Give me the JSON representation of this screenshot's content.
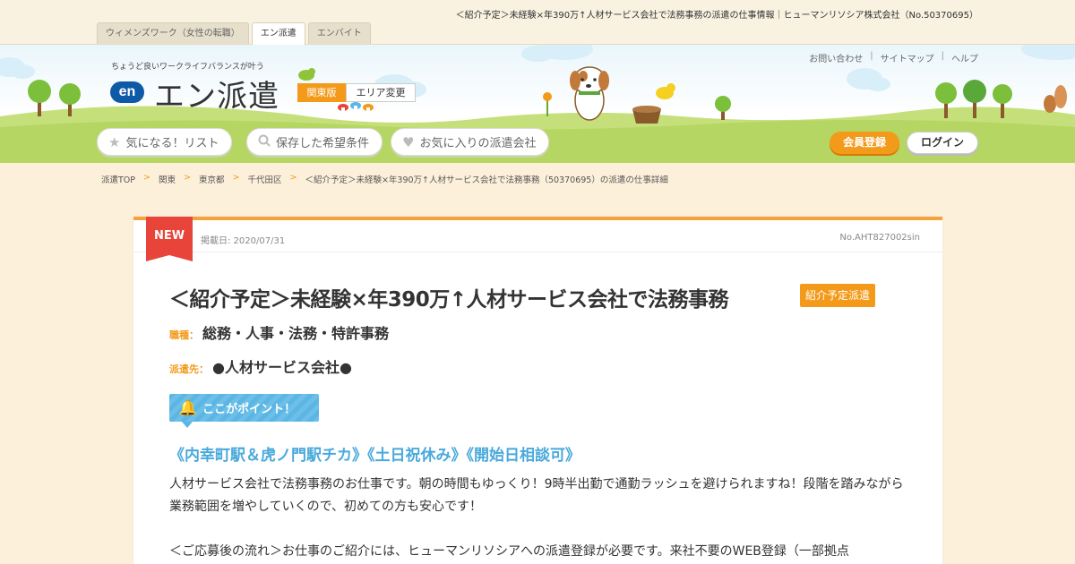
{
  "page_heading": "＜紹介予定＞未経験×年390万↑人材サービス会社で法務事務の派遣の仕事情報｜ヒューマンリソシア株式会社（No.50370695）",
  "site_tabs": [
    {
      "label": "ウィメンズワーク（女性の転職）",
      "active": false
    },
    {
      "label": "エン派遣",
      "active": true
    },
    {
      "label": "エンバイト",
      "active": false
    }
  ],
  "header": {
    "tagline": "ちょうど良いワークライフバランスが叶う",
    "logo_badge": "en",
    "logo_text": "エン派遣",
    "region_label": "関東版",
    "area_change_label": "エリア変更",
    "util_links": [
      "お問い合わせ",
      "サイトマップ",
      "ヘルプ"
    ],
    "nav_buttons": [
      {
        "label": "気になる！リスト",
        "icon": "star-icon"
      },
      {
        "label": "保存した希望条件",
        "icon": "search-icon"
      },
      {
        "label": "お気に入りの派遣会社",
        "icon": "heart-icon"
      }
    ],
    "register_label": "会員登録",
    "login_label": "ログイン"
  },
  "breadcrumb": [
    "派遣TOP",
    "関東",
    "東京都",
    "千代田区",
    "＜紹介予定＞未経験×年390万↑人材サービス会社で法務事務（50370695）の派遣の仕事詳細"
  ],
  "job": {
    "new_flag": "NEW",
    "post_date": "掲載日: 2020/07/31",
    "job_no": "No.AHT827002sin",
    "title": "＜紹介予定＞未経験×年390万↑人材サービス会社で法務事務",
    "title_badge": "紹介予定派遣",
    "occupation_label": "職種：",
    "occupation": "総務・人事・法務・特許事務",
    "dispatch_label": "派遣先：",
    "dispatch": "●人材サービス会社●",
    "point_label": "ここがポイント！",
    "highlight": "《内幸町駅＆虎ノ門駅チカ》《土日祝休み》《開始日相談可》",
    "description": "人材サービス会社で法務事務のお仕事です。朝の時間もゆっくり！9時半出勤で通勤ラッシュを避けられますね！段階を踏みながら業務範囲を増やしていくので、初めての方も安心です！",
    "flow_text": "＜ご応募後の流れ＞お仕事のご紹介には、ヒューマンリソシアへの派遣登録が必要です。来社不要のWEB登録（一部拠点"
  },
  "colors": {
    "accent_orange": "#f39a1a",
    "new_red": "#e8443a",
    "point_blue": "#5ab6e4",
    "page_bg": "#fdf0da"
  }
}
